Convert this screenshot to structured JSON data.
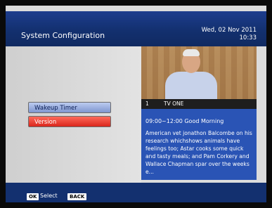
{
  "header": {
    "title": "System Configuration",
    "date": "Wed, 02 Nov 2011",
    "time": "10:33"
  },
  "menu": {
    "items": [
      {
        "label": "Wakeup Timer",
        "state": "normal"
      },
      {
        "label": "Version",
        "state": "selected"
      }
    ]
  },
  "preview": {
    "channel_number": "1",
    "channel_name": "TV ONE",
    "program_time_title": "09:00~12:00  Good Morning",
    "program_description": "American vet jonathon Balcombe on his research whichshows animals have feelings too; Astar cooks some quick and tasty meals; and Pam Corkery and Wallace Chapman spar over the weeks e..."
  },
  "footer": {
    "ok_key": "OK",
    "select_label": "Select",
    "back_key": "BACK"
  },
  "colors": {
    "header_blue": "#13306f",
    "preview_blue": "#2a54b5",
    "selected_red": "#d9261c",
    "normal_button": "#7f96cf"
  }
}
